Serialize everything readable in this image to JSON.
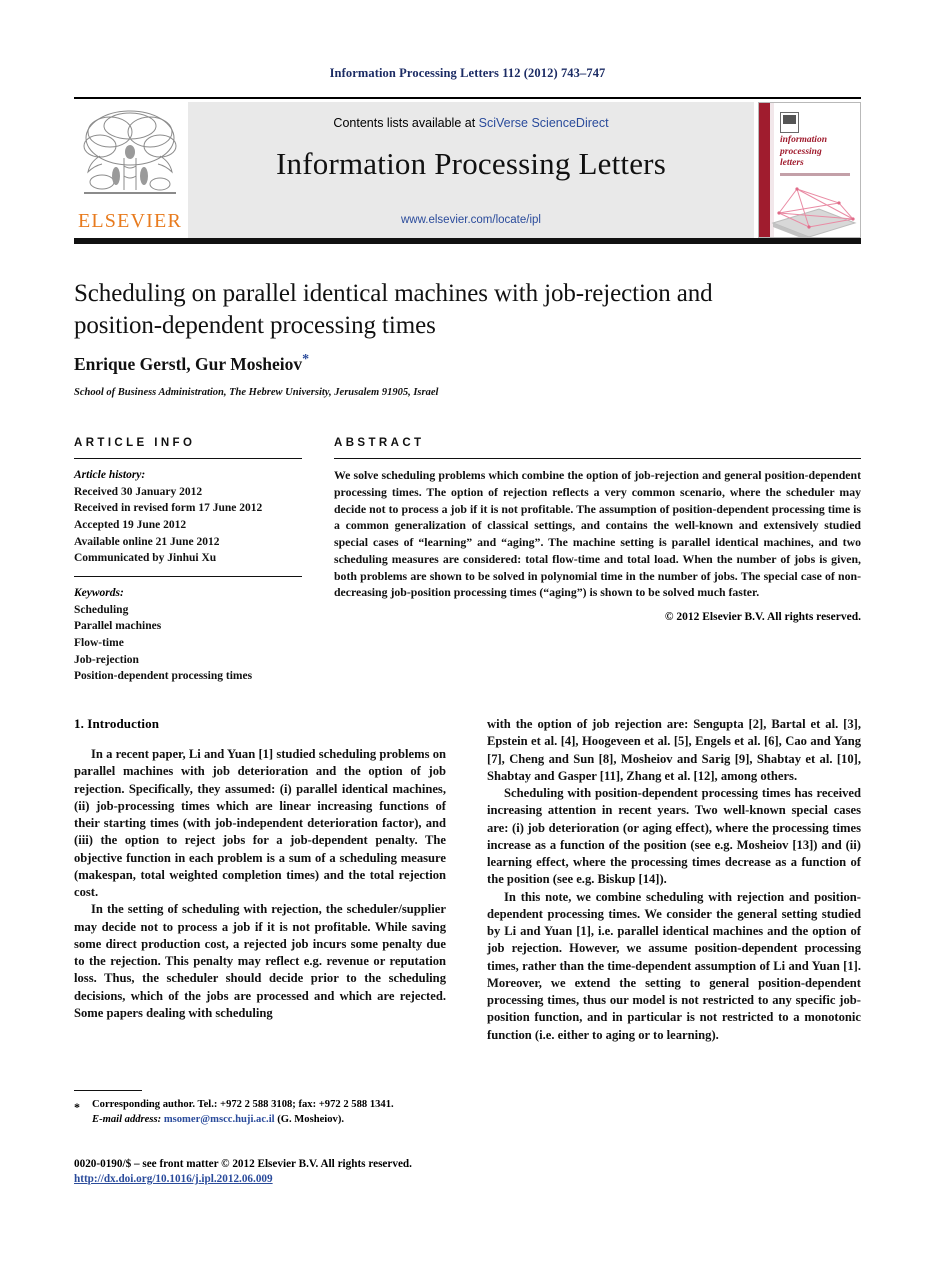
{
  "running_head": "Information Processing Letters 112 (2012) 743–747",
  "masthead": {
    "publisher_logo_text": "ELSEVIER",
    "contents_prefix": "Contents lists available at",
    "contents_link": "SciVerse ScienceDirect",
    "journal_name": "Information Processing Letters",
    "journal_url": "www.elsevier.com/locate/ipl",
    "cover": {
      "title_lines": [
        "information",
        "processing",
        "letters"
      ],
      "spine_color": "#a01c2e",
      "art_color": "#e98ba4"
    }
  },
  "article": {
    "title": "Scheduling on parallel identical machines with job-rejection and position-dependent processing times",
    "authors": "Enrique Gerstl, Gur Mosheiov",
    "corresponding_marker": "*",
    "affiliation": "School of Business Administration, The Hebrew University, Jerusalem 91905, Israel"
  },
  "info": {
    "heading": "ARTICLE INFO",
    "history_label": "Article history:",
    "history": [
      "Received 30 January 2012",
      "Received in revised form 17 June 2012",
      "Accepted 19 June 2012",
      "Available online 21 June 2012",
      "Communicated by Jinhui Xu"
    ],
    "keywords_label": "Keywords:",
    "keywords": [
      "Scheduling",
      "Parallel machines",
      "Flow-time",
      "Job-rejection",
      "Position-dependent processing times"
    ]
  },
  "abstract": {
    "heading": "ABSTRACT",
    "text": "We solve scheduling problems which combine the option of job-rejection and general position-dependent processing times. The option of rejection reflects a very common scenario, where the scheduler may decide not to process a job if it is not profitable. The assumption of position-dependent processing time is a common generalization of classical settings, and contains the well-known and extensively studied special cases of “learning” and “aging”. The machine setting is parallel identical machines, and two scheduling measures are considered: total flow-time and total load. When the number of jobs is given, both problems are shown to be solved in polynomial time in the number of jobs. The special case of non-decreasing job-position processing times (“aging”) is shown to be solved much faster.",
    "copyright": "© 2012 Elsevier B.V. All rights reserved."
  },
  "body": {
    "section_heading": "1. Introduction",
    "left_paragraphs": [
      "In a recent paper, Li and Yuan [1] studied scheduling problems on parallel machines with job deterioration and the option of job rejection. Specifically, they assumed: (i) parallel identical machines, (ii) job-processing times which are linear increasing functions of their starting times (with job-independent deterioration factor), and (iii) the option to reject jobs for a job-dependent penalty. The objective function in each problem is a sum of a scheduling measure (makespan, total weighted completion times) and the total rejection cost.",
      "In the setting of scheduling with rejection, the scheduler/supplier may decide not to process a job if it is not profitable. While saving some direct production cost, a rejected job incurs some penalty due to the rejection. This penalty may reflect e.g. revenue or reputation loss. Thus, the scheduler should decide prior to the scheduling decisions, which of the jobs are processed and which are rejected. Some papers dealing with scheduling"
    ],
    "right_paragraphs": [
      "with the option of job rejection are: Sengupta [2], Bartal et al. [3], Epstein et al. [4], Hoogeveen et al. [5], Engels et al. [6], Cao and Yang [7], Cheng and Sun [8], Mosheiov and Sarig [9], Shabtay et al. [10], Shabtay and Gasper [11], Zhang et al. [12], among others.",
      "Scheduling with position-dependent processing times has received increasing attention in recent years. Two well-known special cases are: (i) job deterioration (or aging effect), where the processing times increase as a function of the position (see e.g. Mosheiov [13]) and (ii) learning effect, where the processing times decrease as a function of the position (see e.g. Biskup [14]).",
      "In this note, we combine scheduling with rejection and position-dependent processing times. We consider the general setting studied by Li and Yuan [1], i.e. parallel identical machines and the option of job rejection. However, we assume position-dependent processing times, rather than the time-dependent assumption of Li and Yuan [1]. Moreover, we extend the setting to general position-dependent processing times, thus our model is not restricted to any specific job-position function, and in particular is not restricted to a monotonic function (i.e. either to aging or to learning)."
    ]
  },
  "footnote": {
    "star": "*",
    "corresponding": "Corresponding author. Tel.: +972 2 588 3108; fax: +972 2 588 1341.",
    "email_label": "E-mail address:",
    "email": "msomer@mscc.huji.ac.il",
    "email_owner": "(G. Mosheiov)."
  },
  "imprint": {
    "issn_line": "0020-0190/$ – see front matter © 2012 Elsevier B.V. All rights reserved.",
    "doi": "http://dx.doi.org/10.1016/j.ipl.2012.06.009"
  }
}
